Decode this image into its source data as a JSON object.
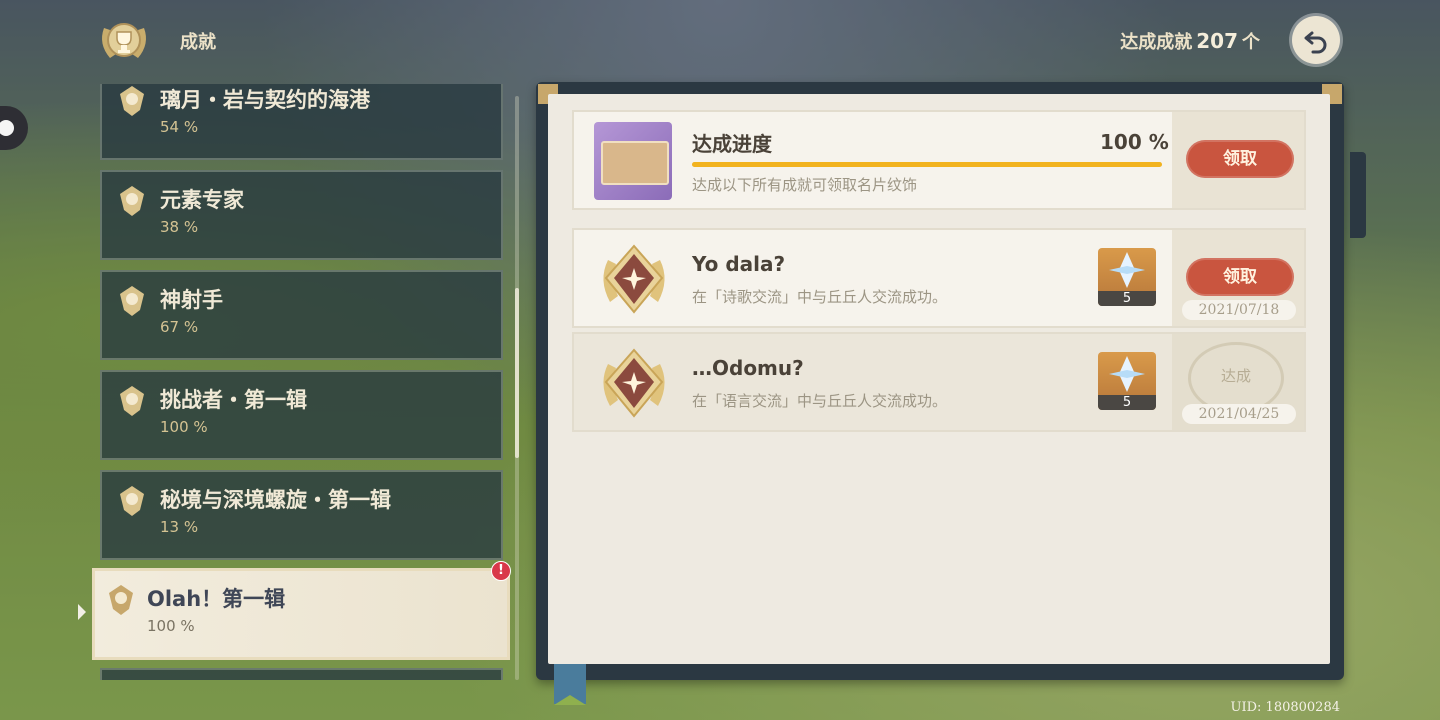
{
  "header": {
    "title": "成就",
    "count_prefix": "达成成就",
    "count_value": "207",
    "count_suffix": "个"
  },
  "categories": [
    {
      "name": "璃月・岩与契约的海港",
      "percent": "54 %"
    },
    {
      "name": "元素专家",
      "percent": "38 %"
    },
    {
      "name": "神射手",
      "percent": "67 %"
    },
    {
      "name": "挑战者・第一辑",
      "percent": "100 %"
    },
    {
      "name": "秘境与深境螺旋・第一辑",
      "percent": "13 %"
    },
    {
      "name": "Olah！第一辑",
      "percent": "100 %",
      "selected": true,
      "badge": "!"
    }
  ],
  "progress": {
    "title": "达成进度",
    "percent_text": "100 %",
    "fill": 1.0,
    "description": "达成以下所有成就可领取名片纹饰",
    "claim_label": "领取"
  },
  "achievements": [
    {
      "title": "Yo dala?",
      "description": "在「诗歌交流」中与丘丘人交流成功。",
      "reward_qty": "5",
      "status": "claim",
      "claim_label": "领取",
      "date": "2021/07/18"
    },
    {
      "title": "…Odomu?",
      "description": "在「语言交流」中与丘丘人交流成功。",
      "reward_qty": "5",
      "status": "done",
      "done_label": "达成",
      "date": "2021/04/25"
    }
  ],
  "uid": "UID: 180800284",
  "colors": {
    "accent_button": "#c9553f",
    "progress_fill": "#f2b31f",
    "panel_dark": "#283a40"
  }
}
